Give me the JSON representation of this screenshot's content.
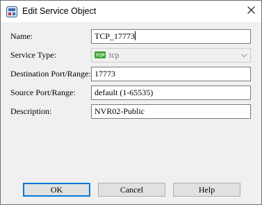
{
  "window": {
    "title": "Edit Service Object",
    "icon": "network-object-icon",
    "close_icon": "close-icon"
  },
  "form": {
    "name": {
      "label": "Name:",
      "value": "TCP_17773"
    },
    "service_type": {
      "label": "Service Type:",
      "value": "tcp",
      "badge": "TCP",
      "badge_color": "#3aa635",
      "disabled": true
    },
    "destination_port": {
      "label": "Destination Port/Range:",
      "value": "17773"
    },
    "source_port": {
      "label": "Source Port/Range:",
      "value": "default (1-65535)"
    },
    "description": {
      "label": "Description:",
      "value": "NVR02-Public"
    }
  },
  "buttons": {
    "ok": "OK",
    "cancel": "Cancel",
    "help": "Help"
  },
  "colors": {
    "accent": "#0078d7",
    "dialog_background": "#f0f0f0"
  }
}
